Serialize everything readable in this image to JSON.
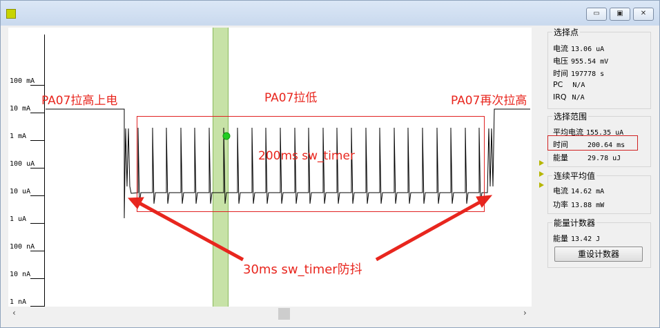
{
  "window": {
    "controls": {
      "minimize": "▭",
      "maximize": "▣",
      "close": "✕"
    }
  },
  "plot": {
    "y_ticks": [
      "100 mA",
      "10 mA",
      "1 mA",
      "100 uA",
      "10 uA",
      "1 uA",
      "100 nA",
      "10 nA",
      "1 nA"
    ],
    "annotations": {
      "power_on": "PA07拉高上电",
      "pull_low": "PA07拉低",
      "pull_high_again": "PA07再次拉高",
      "timer_200": "200ms sw_timer",
      "debounce": "30ms sw_timer防抖"
    },
    "colors": {
      "trace": "#000000",
      "annotation": "#e8261e",
      "cursor": "#c7e2a7",
      "marker": "#22cc22"
    }
  },
  "panel": {
    "selection_point": {
      "title": "选择点",
      "rows": [
        {
          "k": "电流",
          "v": "13.06 uA"
        },
        {
          "k": "电压",
          "v": "955.54 mV"
        },
        {
          "k": "时间",
          "v": "197778 s"
        },
        {
          "k": "PC",
          "v": "N/A"
        },
        {
          "k": "IRQ",
          "v": "N/A"
        }
      ]
    },
    "selection_range": {
      "title": "选择范围",
      "rows": [
        {
          "k": "平均电流",
          "v": "155.35 uA"
        },
        {
          "k": "时间",
          "v": "200.64 ms"
        },
        {
          "k": "能量",
          "v": "29.78 uJ"
        }
      ]
    },
    "continuous_average": {
      "title": "连续平均值",
      "rows": [
        {
          "k": "电流",
          "v": "14.62 mA"
        },
        {
          "k": "功率",
          "v": "13.88 mW"
        }
      ]
    },
    "energy_counter": {
      "title": "能量计数器",
      "rows": [
        {
          "k": "能量",
          "v": "13.42 J"
        }
      ],
      "reset_label": "重设计数器"
    }
  },
  "scrollbar": {
    "left": "‹",
    "right": "›"
  }
}
